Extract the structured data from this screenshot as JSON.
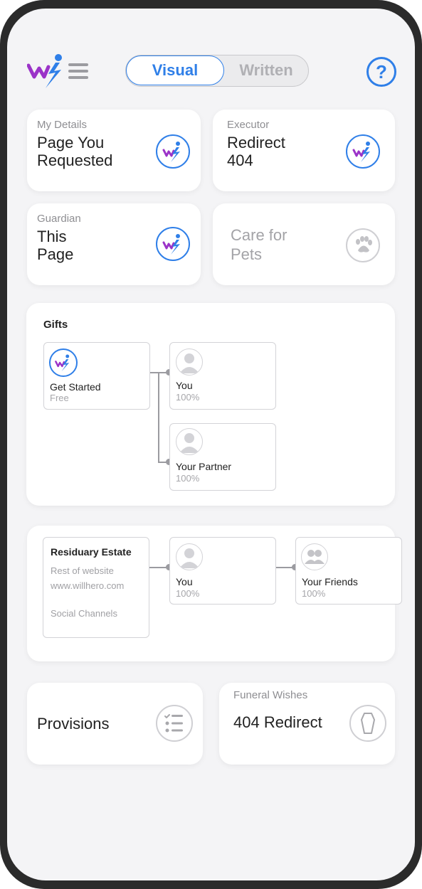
{
  "header": {
    "logo_icon": "willhero-logo",
    "menu_icon": "hamburger-menu-icon",
    "toggle": {
      "active": "Visual",
      "inactive": "Written"
    },
    "help_icon": "question-mark-icon",
    "help_label": "?"
  },
  "tiles": {
    "details": {
      "caption": "My Details",
      "line1": "Page You",
      "line2": "Requested",
      "icon": "willhero-badge-icon"
    },
    "executor": {
      "caption": "Executor",
      "line1": "Redirect",
      "line2": "404",
      "icon": "willhero-badge-icon"
    },
    "guardian": {
      "caption": "Guardian",
      "line1": "This",
      "line2": "Page",
      "icon": "willhero-badge-icon"
    },
    "pets": {
      "line1": "Care for",
      "line2": "Pets",
      "icon": "paw-icon"
    }
  },
  "gifts": {
    "title": "Gifts",
    "source": {
      "name": "Get Started",
      "sub": "Free",
      "icon": "willhero-badge-icon"
    },
    "beneficiaries": [
      {
        "name": "You",
        "pct": "100%",
        "icon": "person-avatar-icon"
      },
      {
        "name": "Your Partner",
        "pct": "100%",
        "icon": "person-avatar-icon"
      }
    ]
  },
  "residuary": {
    "title": "Residuary Estate",
    "lines": [
      "Rest of website",
      "www.willhero.com",
      "Social Channels"
    ],
    "beneficiaries": [
      {
        "name": "You",
        "pct": "100%",
        "icon": "person-avatar-icon"
      },
      {
        "name": "Your Friends",
        "pct": "100%",
        "icon": "group-avatar-icon"
      }
    ]
  },
  "bottom": {
    "provisions": {
      "label": "Provisions",
      "icon": "checklist-icon"
    },
    "funeral": {
      "caption": "Funeral Wishes",
      "label": "404 Redirect",
      "icon": "coffin-icon"
    }
  },
  "colors": {
    "accent": "#2f7fe8",
    "brand_purple": "#9b33c8",
    "background": "#f4f4f6"
  }
}
